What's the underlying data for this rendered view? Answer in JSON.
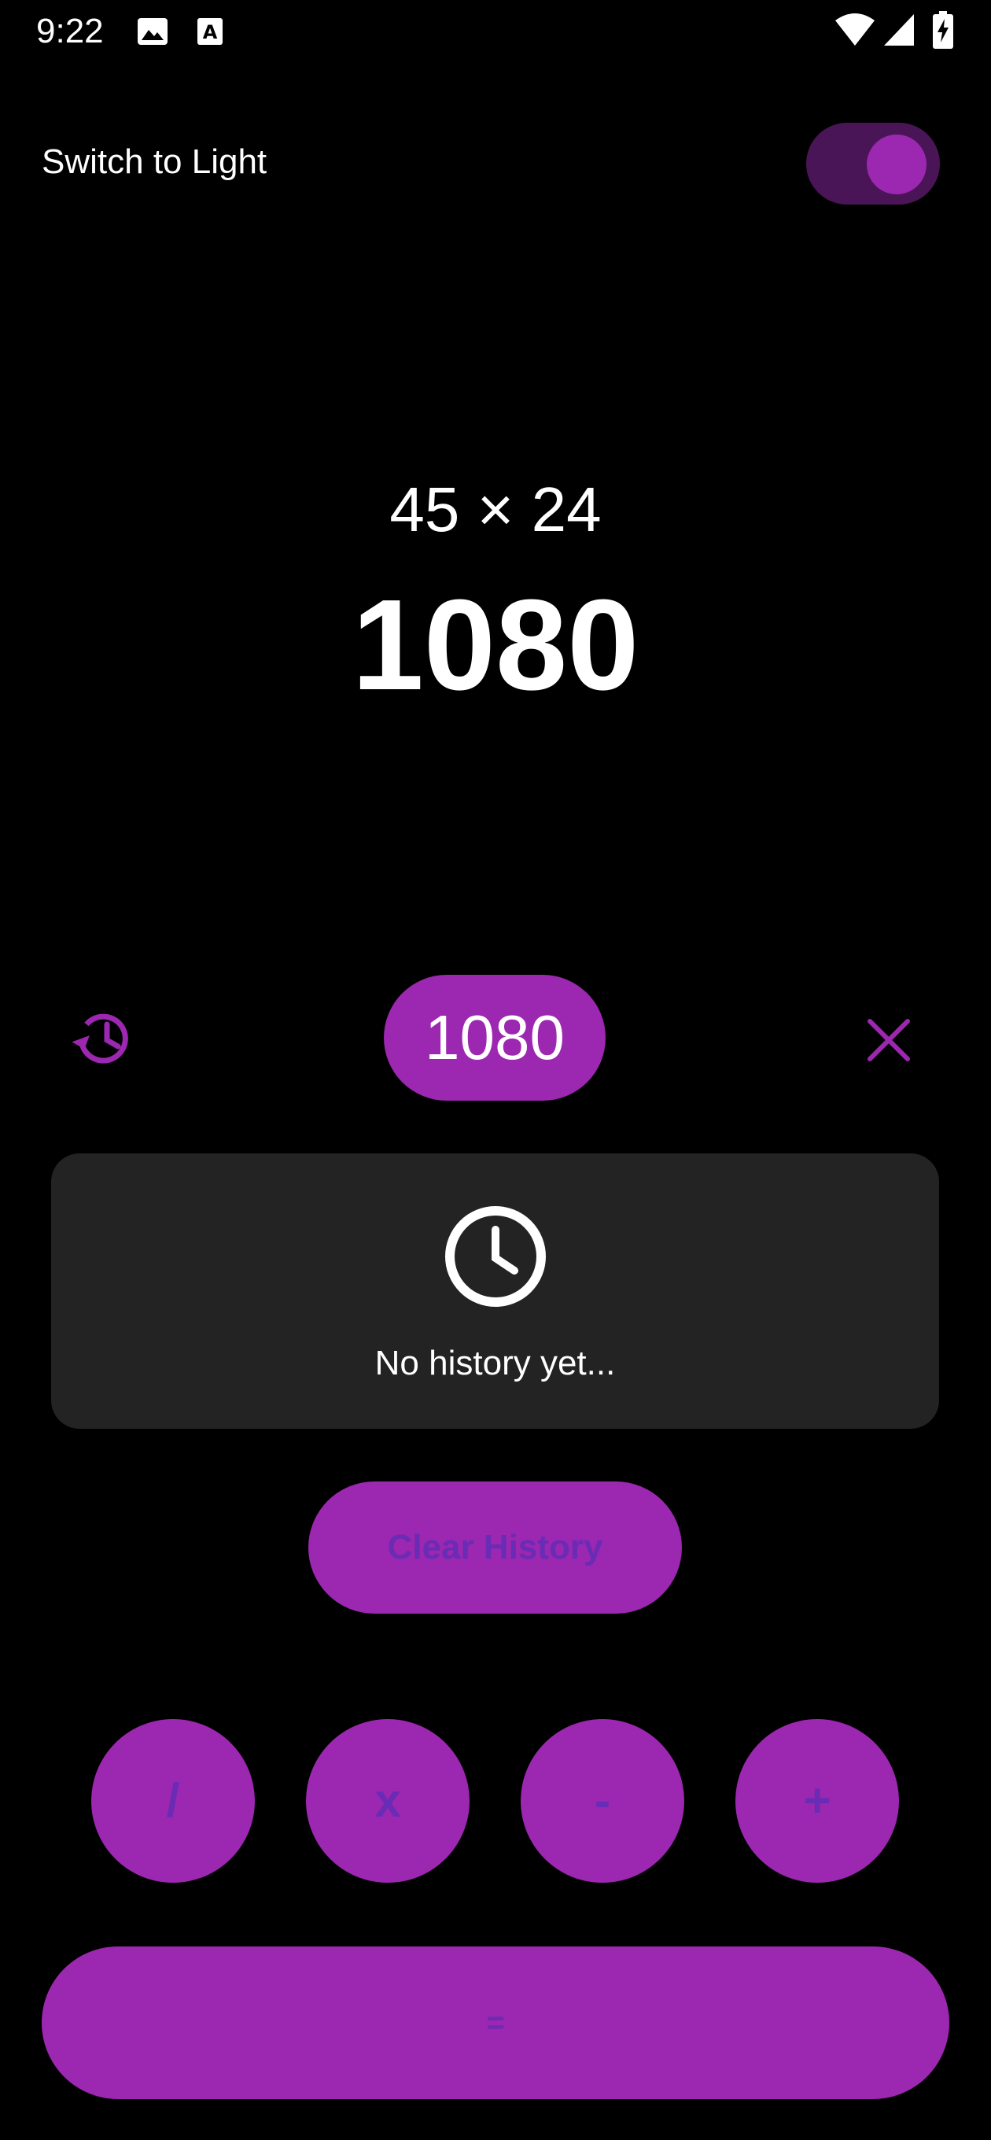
{
  "status_bar": {
    "time": "9:22",
    "icons": [
      "image-icon",
      "text-a-icon",
      "wifi-icon",
      "cellular-signal-icon",
      "battery-charging-icon"
    ]
  },
  "theme": {
    "label": "Switch to Light",
    "toggle_on": true
  },
  "display": {
    "expression": "45 × 24",
    "result": "1080"
  },
  "actions": {
    "result_chip": "1080",
    "history_icon": "history-icon",
    "close_icon": "close-icon"
  },
  "history": {
    "empty_icon": "clock-icon",
    "empty_message": "No history yet...",
    "clear_label": "Clear History"
  },
  "operators": {
    "divide": "/",
    "multiply": "x",
    "subtract": "-",
    "add": "+",
    "equals": "="
  },
  "colors": {
    "accent": "#9c27b0",
    "accent_dark": "#4a1556",
    "button_text": "#6a2bb5",
    "background": "#000000",
    "panel": "#232323"
  }
}
